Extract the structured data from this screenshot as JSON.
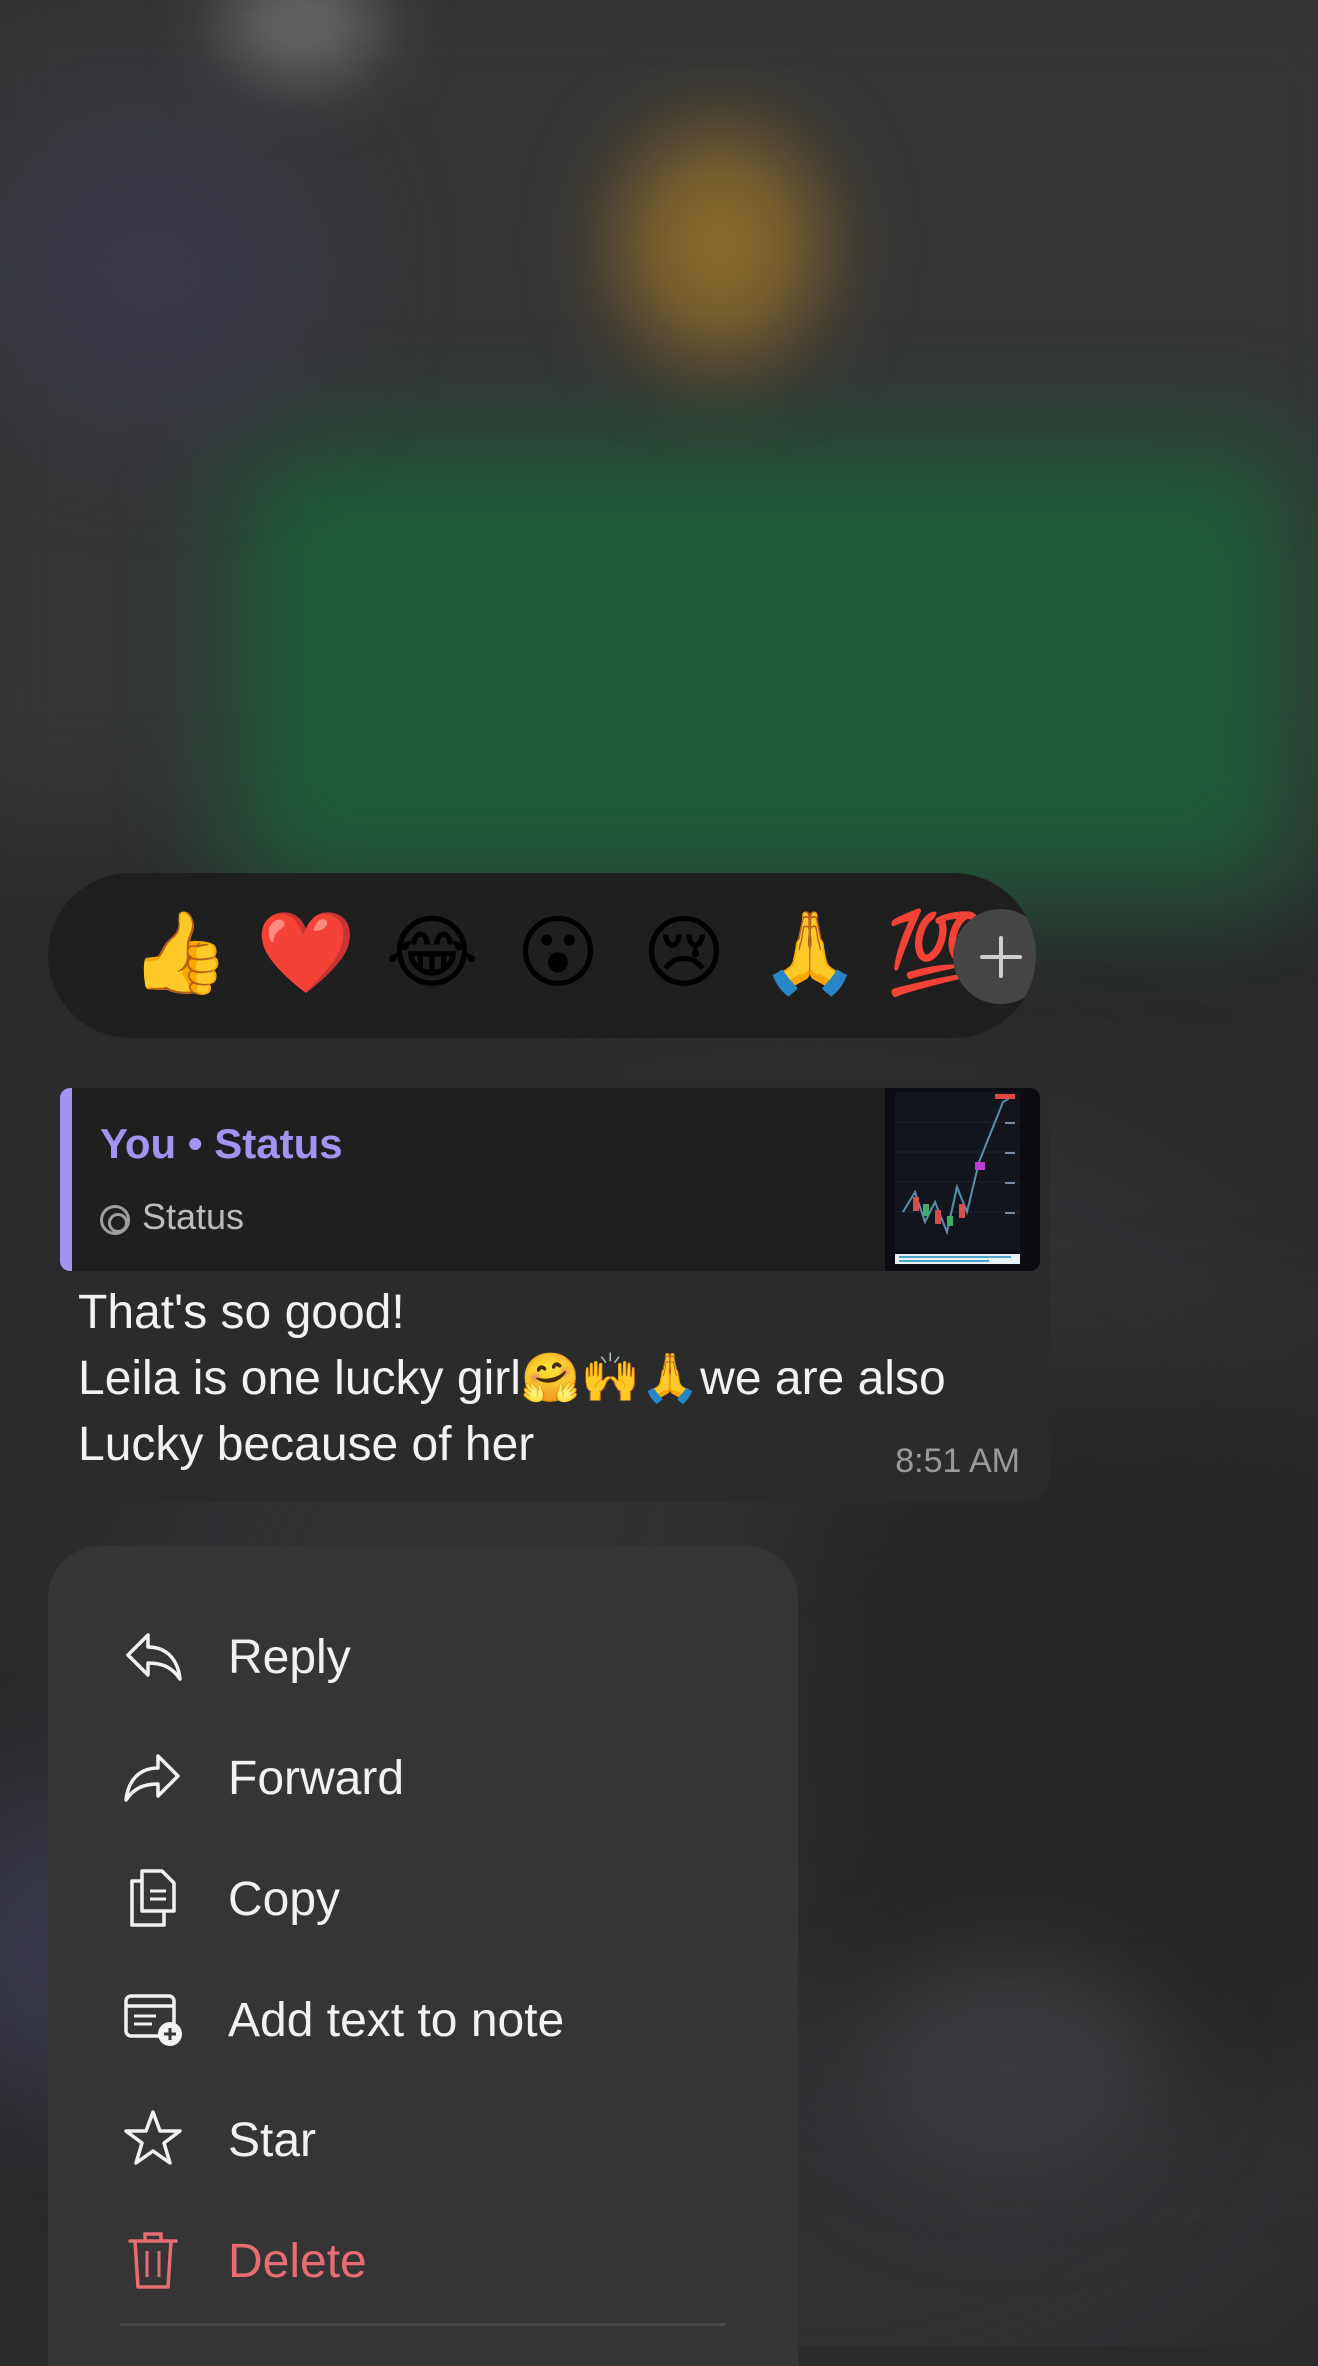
{
  "reactions": {
    "items": [
      {
        "name": "thumbs-up",
        "glyph": "👍"
      },
      {
        "name": "red-heart",
        "glyph": "❤️"
      },
      {
        "name": "tears-of-joy",
        "glyph": "😂"
      },
      {
        "name": "surprised",
        "glyph": "😮"
      },
      {
        "name": "crying",
        "glyph": "😢"
      },
      {
        "name": "folded-hands",
        "glyph": "🙏"
      },
      {
        "name": "hundred-points",
        "glyph": "💯"
      }
    ],
    "add_icon": "plus-icon"
  },
  "message": {
    "quote_title": "You • Status",
    "quote_sub": "Status",
    "line1": "That's so good!",
    "line2": "Leila is one lucky girl🤗🙌🙏we are also",
    "line3": "Lucky because of her",
    "time": "8:51 AM"
  },
  "menu": {
    "reply": "Reply",
    "forward": "Forward",
    "copy": "Copy",
    "add_note": "Add text to note",
    "star": "Star",
    "delete": "Delete"
  },
  "colors": {
    "accent_purple": "#a593f2",
    "danger": "#e76c73",
    "bubble": "#2b2b2b",
    "menu": "#353535"
  }
}
